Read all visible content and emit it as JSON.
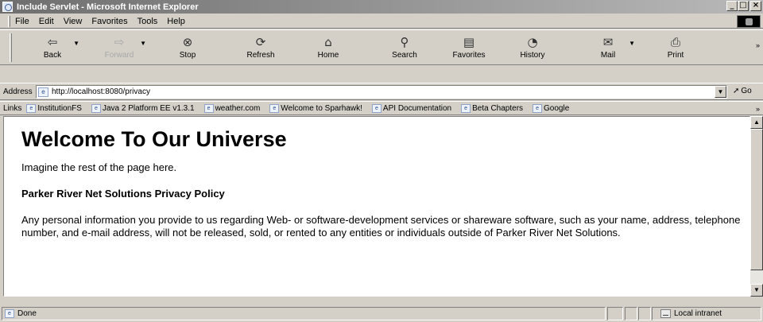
{
  "window": {
    "title": "Include Servlet - Microsoft Internet Explorer",
    "minimize": "_",
    "maximize": "□",
    "close": "×"
  },
  "menu": {
    "items": [
      "File",
      "Edit",
      "View",
      "Favorites",
      "Tools",
      "Help"
    ]
  },
  "toolbar": {
    "back": "Back",
    "forward": "Forward",
    "stop": "Stop",
    "refresh": "Refresh",
    "home": "Home",
    "search": "Search",
    "favorites": "Favorites",
    "history": "History",
    "mail": "Mail",
    "print": "Print",
    "more": "»"
  },
  "address": {
    "label": "Address",
    "url": "http://localhost:8080/privacy",
    "go": "Go"
  },
  "links": {
    "label": "Links",
    "items": [
      "InstitutionFS",
      "Java 2 Platform EE v1.3.1",
      "weather.com",
      "Welcome to Sparhawk!",
      "API Documentation",
      "Beta Chapters",
      "Google"
    ],
    "more": "»"
  },
  "page": {
    "heading": "Welcome To Our Universe",
    "intro": "Imagine the rest of the page here.",
    "policy_title": "Parker River Net Solutions Privacy Policy",
    "policy_text": "Any personal information you provide to us regarding Web- or software-development services or shareware software, such as your name, address, telephone number, and e-mail address, will not be released, sold, or rented to any entities or individuals outside of Parker River Net Solutions."
  },
  "status": {
    "text": "Done",
    "zone": "Local intranet"
  }
}
